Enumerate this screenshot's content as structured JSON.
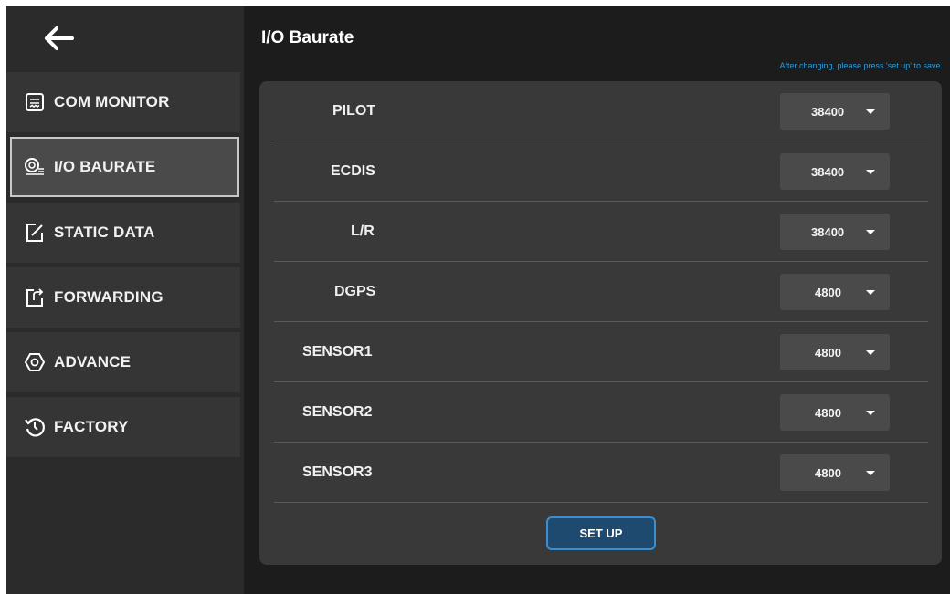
{
  "header": {
    "title": "I/O Baurate",
    "hint": "After changing, please press 'set up' to save."
  },
  "sidebar": {
    "back_icon": "back-arrow-icon",
    "items": [
      {
        "label": "COM MONITOR",
        "icon": "monitor-log-icon",
        "active": false
      },
      {
        "label": "I/O BAURATE",
        "icon": "io-baurate-icon",
        "active": true
      },
      {
        "label": "STATIC DATA",
        "icon": "edit-icon",
        "active": false
      },
      {
        "label": "FORWARDING",
        "icon": "forward-icon",
        "active": false
      },
      {
        "label": "ADVANCE",
        "icon": "hexagon-icon",
        "active": false
      },
      {
        "label": "FACTORY",
        "icon": "restore-icon",
        "active": false
      }
    ]
  },
  "ports": [
    {
      "label": "PILOT",
      "value": "38400"
    },
    {
      "label": "ECDIS",
      "value": "38400"
    },
    {
      "label": "L/R",
      "value": "38400"
    },
    {
      "label": "DGPS",
      "value": "4800"
    },
    {
      "label": "SENSOR1",
      "value": "4800"
    },
    {
      "label": "SENSOR2",
      "value": "4800"
    },
    {
      "label": "SENSOR3",
      "value": "4800"
    }
  ],
  "actions": {
    "setup_label": "SET UP"
  },
  "colors": {
    "accent": "#3b8fd1",
    "hint": "#2f9bd6",
    "panel": "#393939",
    "sidebar": "#2b2b2b"
  }
}
